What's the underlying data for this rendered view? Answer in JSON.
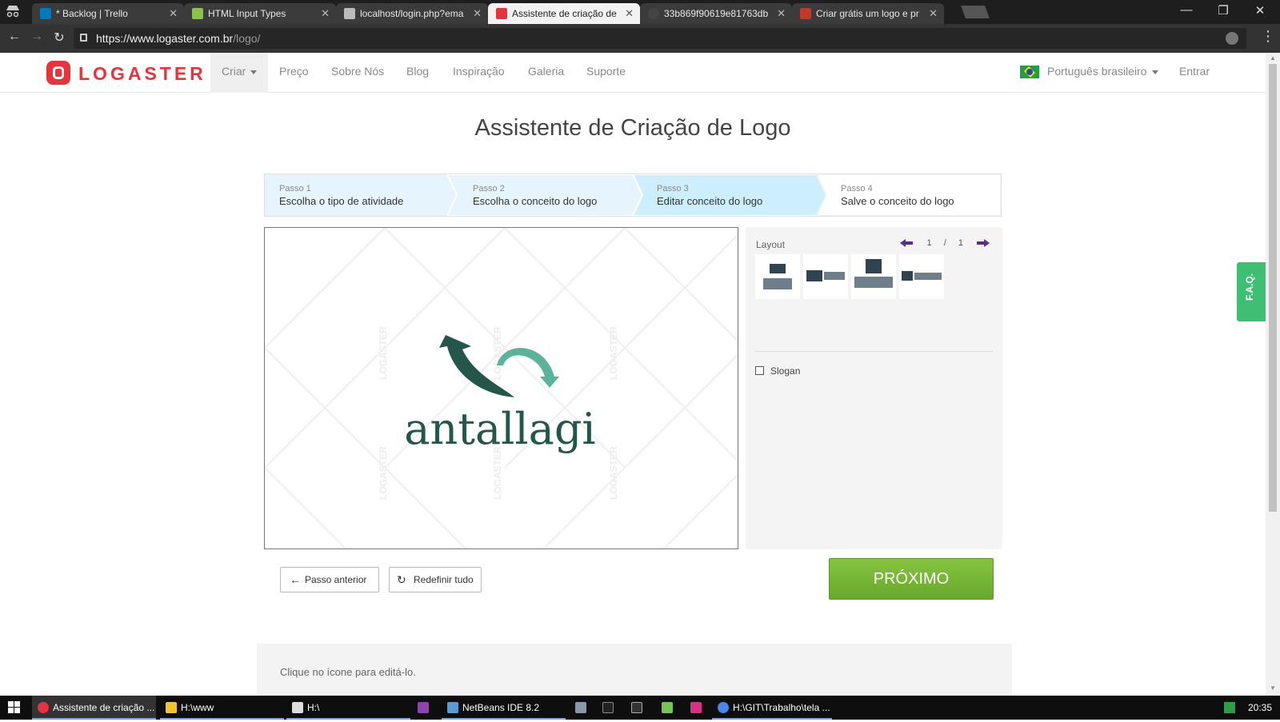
{
  "browser": {
    "tabs": [
      {
        "title": "* Backlog | Trello",
        "color": "#0079bf"
      },
      {
        "title": "HTML Input Types",
        "color": "#8bc34a"
      },
      {
        "title": "localhost/login.php?ema",
        "color": "#cccccc"
      },
      {
        "title": "Assistente de criação de",
        "color": "#e8333c"
      },
      {
        "title": "33b869f90619e81763db",
        "color": "#444444"
      },
      {
        "title": "Criar grátis um logo e pr",
        "color": "#c0392b"
      }
    ],
    "url_host": "https://www.logaster.com.br",
    "url_path": "/logo/"
  },
  "site": {
    "brand": "LOGASTER",
    "brand_color": "#e8333c",
    "nav": [
      "Criar",
      "Preço",
      "Sobre Nós",
      "Blog",
      "Inspiração",
      "Galeria",
      "Suporte"
    ],
    "language": "Português brasileiro",
    "login": "Entrar"
  },
  "wizard": {
    "title": "Assistente de Criação de Logo",
    "steps": [
      {
        "num": "Passo 1",
        "label": "Escolha o tipo de atividade"
      },
      {
        "num": "Passo 2",
        "label": "Escolha o conceito do logo"
      },
      {
        "num": "Passo 3",
        "label": "Editar conceito do logo"
      },
      {
        "num": "Passo 4",
        "label": "Salve o conceito do logo"
      }
    ],
    "current_step": 3,
    "watermark": "LOGASTER",
    "logo_text": "antallagi",
    "layout_label": "Layout",
    "page_current": "1",
    "page_sep": "/",
    "page_total": "1",
    "slogan_label": "Slogan",
    "slogan_checked": false,
    "back_label": "Passo anterior",
    "reset_label": "Redefinir tudo",
    "next_label": "PRÓXIMO",
    "hint": "Clique no ícone para editá-lo.",
    "faq": "F.A.Q."
  },
  "taskbar": {
    "items": [
      {
        "label": "Assistente de criação ...",
        "color": "#e8333c"
      },
      {
        "label": "H:\\www",
        "color": "#f1c232"
      },
      {
        "label": "H:\\",
        "color": "#dddddd"
      },
      {
        "label": "",
        "color": "#8e44ad"
      },
      {
        "label": "NetBeans IDE 8.2",
        "color": "#5b9bd5"
      },
      {
        "label": "",
        "color": "#8899aa"
      },
      {
        "label": "",
        "color": "#222222"
      },
      {
        "label": "",
        "color": "#333333"
      },
      {
        "label": "",
        "color": "#78c257"
      },
      {
        "label": "",
        "color": "#d63384"
      },
      {
        "label": "H:\\GIT\\Trabalho\\tela ...",
        "color": "#4a86e8"
      }
    ],
    "clock": "20:35"
  }
}
